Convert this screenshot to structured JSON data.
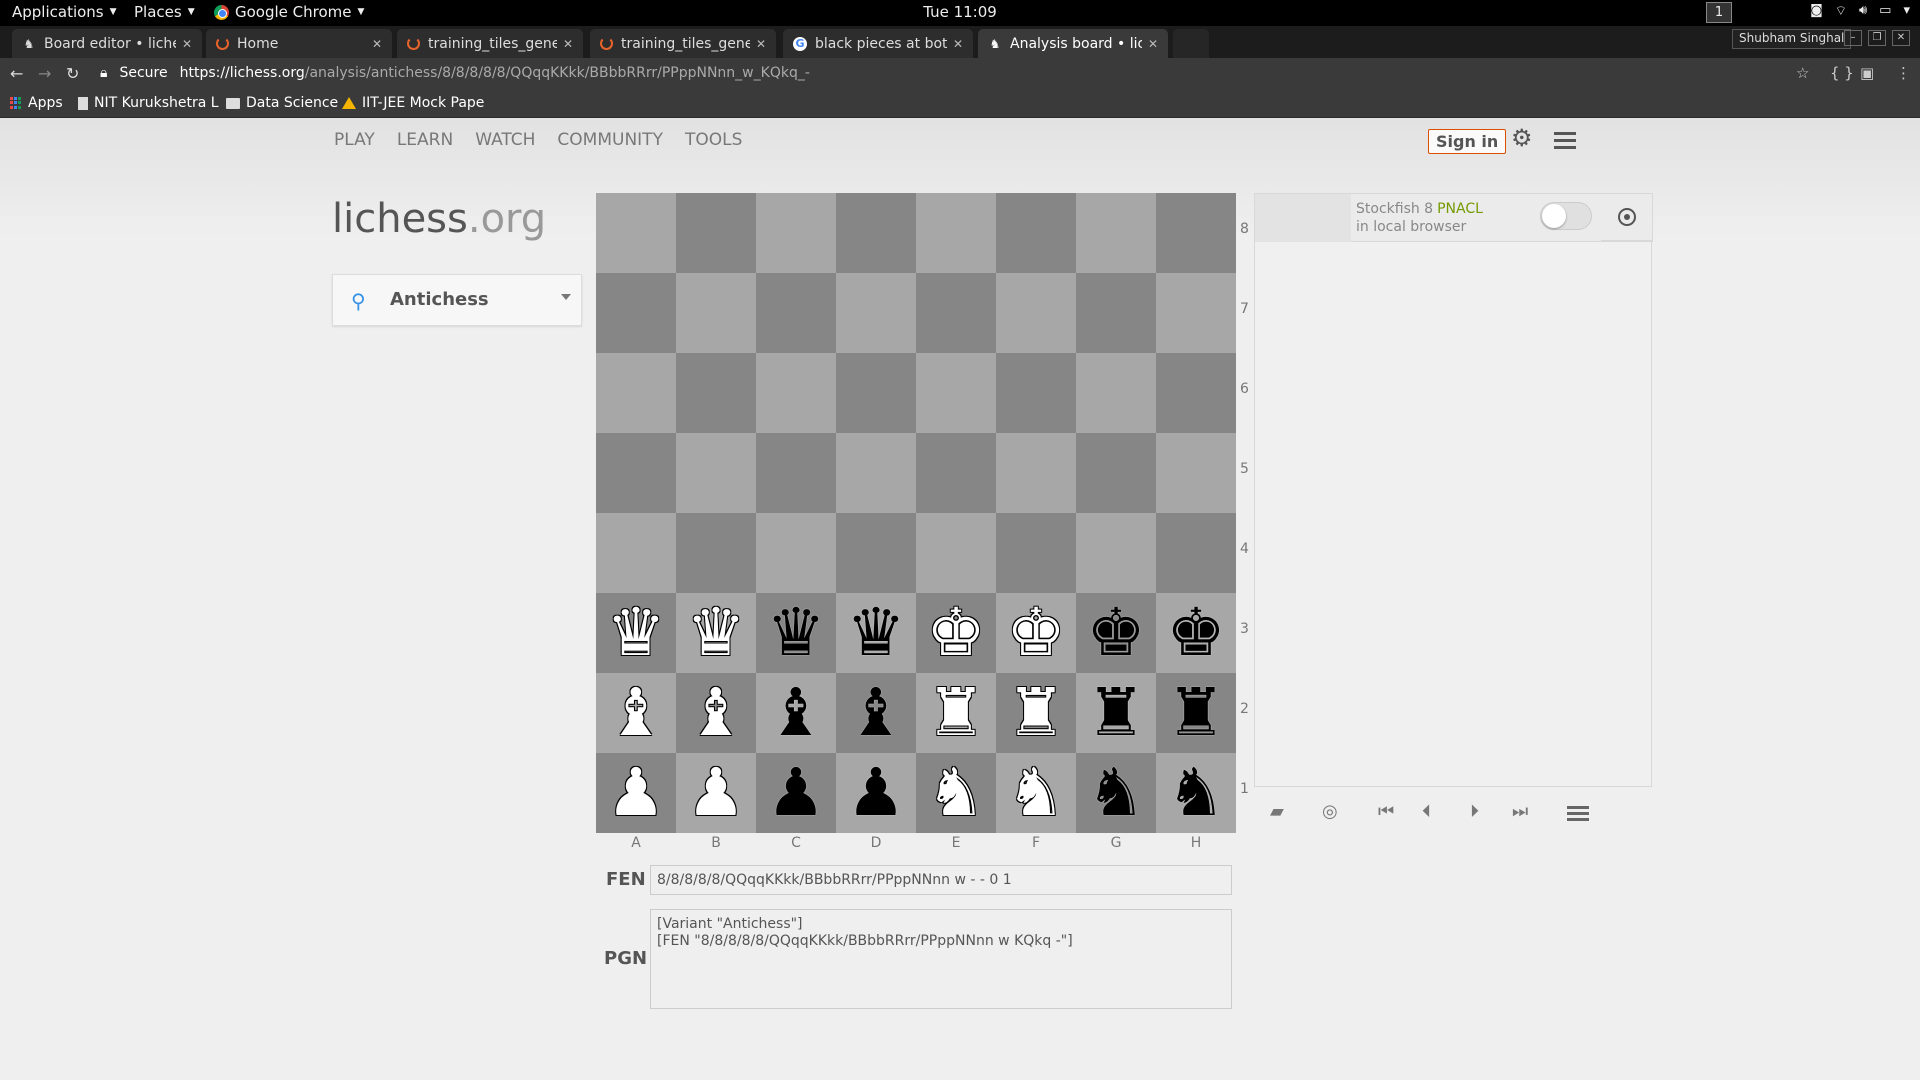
{
  "os_bar": {
    "applications": "Applications",
    "places": "Places",
    "browser_menu": "Google Chrome",
    "clock": "Tue 11:09",
    "workspace": "1"
  },
  "tabs": [
    {
      "title": "Board editor • lichess",
      "icon": "lichess-horse-icon",
      "active": false
    },
    {
      "title": "Home",
      "icon": "jupyter-icon",
      "active": false
    },
    {
      "title": "training_tiles_generator",
      "icon": "jupyter-icon",
      "active": false
    },
    {
      "title": "training_tiles_generator",
      "icon": "jupyter-icon",
      "active": false
    },
    {
      "title": "black pieces at bottom",
      "icon": "google-icon",
      "active": false
    },
    {
      "title": "Analysis board • lichess",
      "icon": "lichess-horse-icon",
      "active": true
    }
  ],
  "profile_name": "Shubham Singhal",
  "address_bar": {
    "secure_label": "Secure",
    "url_host": "https://lichess.org",
    "url_path": "/analysis/antichess/8/8/8/8/8/QQqqKKkk/BBbbRRrr/PPppNNnn_w_KQkq_-"
  },
  "bookmarks": [
    {
      "label": "Apps",
      "icon": "apps-grid-icon"
    },
    {
      "label": "NIT Kurukshetra L",
      "icon": "page-icon"
    },
    {
      "label": "Data Science",
      "icon": "folder-icon"
    },
    {
      "label": "IIT-JEE Mock Pape",
      "icon": "google-drive-icon"
    }
  ],
  "site_nav": {
    "play": "PLAY",
    "learn": "LEARN",
    "watch": "WATCH",
    "community": "COMMUNITY",
    "tools": "TOOLS",
    "sign_in": "Sign in"
  },
  "logo": {
    "name": "lichess",
    "tld": ".org"
  },
  "variant": {
    "label": "Antichess"
  },
  "board": {
    "ranks": [
      "8",
      "7",
      "6",
      "5",
      "4",
      "3",
      "2",
      "1"
    ],
    "files": [
      "A",
      "B",
      "C",
      "D",
      "E",
      "F",
      "G",
      "H"
    ],
    "rows": [
      "........",
      "........",
      "........",
      "........",
      "........",
      "QQqqKKkk",
      "BBbbRRrr",
      "PPppNNnn"
    ]
  },
  "fen": {
    "label": "FEN",
    "value": "8/8/8/8/8/QQqqKKkk/BBbbRRrr/PPppNNnn w - - 0 1"
  },
  "pgn": {
    "label": "PGN",
    "value": "[Variant \"Antichess\"]\n[FEN \"8/8/8/8/8/QQqqKKkk/BBbbRRrr/PPppNNnn w KQkq -\"]"
  },
  "engine": {
    "name": "Stockfish 8",
    "badge": "PNACL",
    "subtitle": "in local browser",
    "enabled": false
  }
}
